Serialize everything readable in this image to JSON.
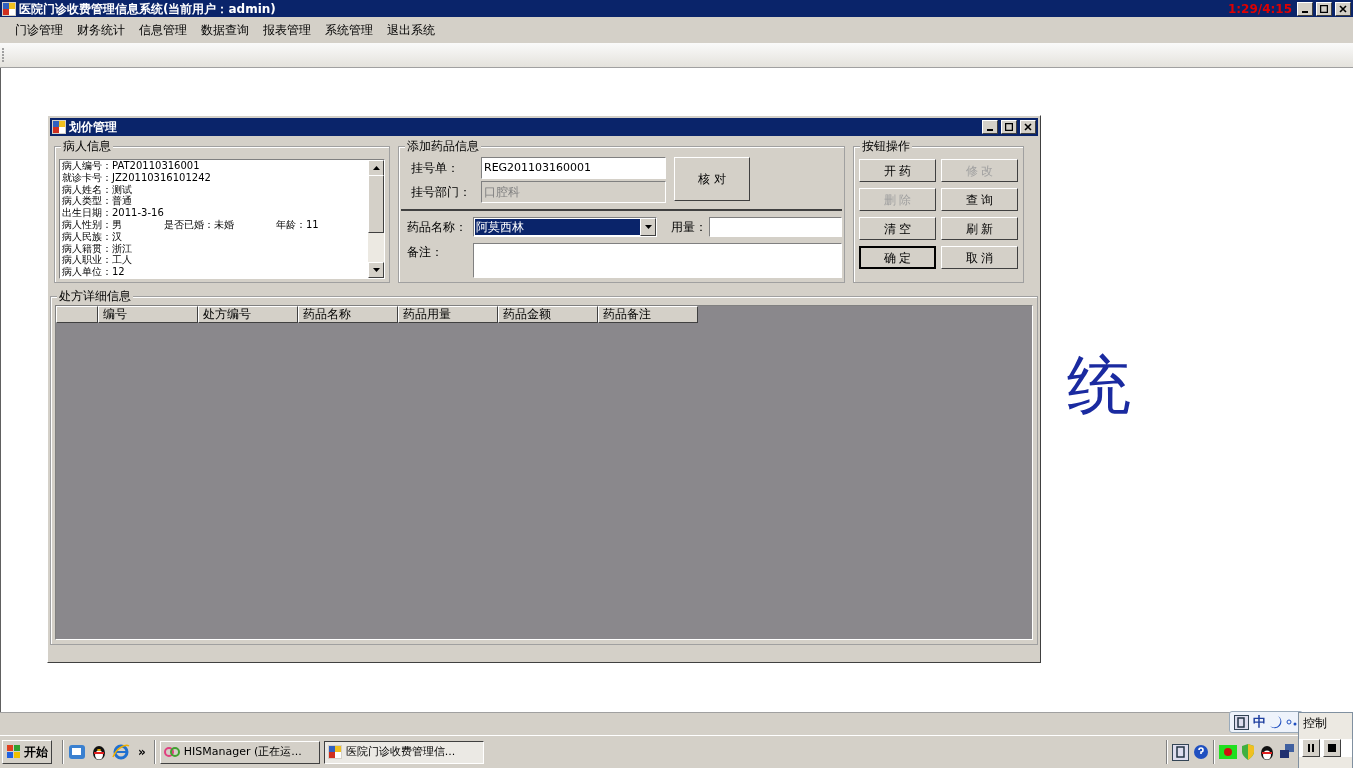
{
  "window": {
    "title": "医院门诊收费管理信息系统(当前用户：admin)",
    "clock": "1:29/4:15"
  },
  "menu": [
    "门诊管理",
    "财务统计",
    "信息管理",
    "数据查询",
    "报表管理",
    "系统管理",
    "退出系统"
  ],
  "background_text": "统",
  "child_window": {
    "title": "划价管理"
  },
  "patient_info": {
    "legend": "病人信息",
    "lines": [
      [
        "病人编号：PAT20110316001"
      ],
      [
        "就诊卡号：JZ20110316101242"
      ],
      [
        "病人姓名：测试"
      ],
      [
        "病人类型：普通"
      ],
      [
        "出生日期：2011-3-16"
      ],
      [
        "病人性别：男",
        "是否已婚：未婚",
        "年龄：11"
      ],
      [
        "病人民族：汉"
      ],
      [
        "病人籍贯：浙江"
      ],
      [
        "病人职业：工人"
      ],
      [
        "病人单位：12"
      ]
    ]
  },
  "add_drug": {
    "legend": "添加药品信息",
    "reg_label": "挂号单：",
    "reg_value": "REG201103160001",
    "dept_label": "挂号部门：",
    "dept_value": "口腔科",
    "check_button": "核 对",
    "drug_label": "药品名称：",
    "drug_value": "阿莫西林",
    "drug_highlighted": true,
    "dose_label": "用量：",
    "note_label": "备注："
  },
  "actions": {
    "legend": "按钮操作",
    "buttons": [
      {
        "label": "开 药",
        "disabled": false,
        "default": false
      },
      {
        "label": "修 改",
        "disabled": true,
        "default": false
      },
      {
        "label": "删 除",
        "disabled": true,
        "default": false
      },
      {
        "label": "查 询",
        "disabled": false,
        "default": false
      },
      {
        "label": "清 空",
        "disabled": false,
        "default": false
      },
      {
        "label": "刷 新",
        "disabled": false,
        "default": false
      },
      {
        "label": "确 定",
        "disabled": false,
        "default": true
      },
      {
        "label": "取 消",
        "disabled": false,
        "default": false
      }
    ]
  },
  "details": {
    "legend": "处方详细信息",
    "columns": [
      "编号",
      "处方编号",
      "药品名称",
      "药品用量",
      "药品金额",
      "药品备注"
    ]
  },
  "taskbar": {
    "start": "开始",
    "more": "»",
    "tasks": [
      {
        "label": "HISManager (正在运...",
        "selected": false
      },
      {
        "label": "医院门诊收费管理信...",
        "selected": true
      }
    ]
  },
  "ime": {
    "language": "中"
  },
  "control_popup": {
    "title": "控制"
  }
}
